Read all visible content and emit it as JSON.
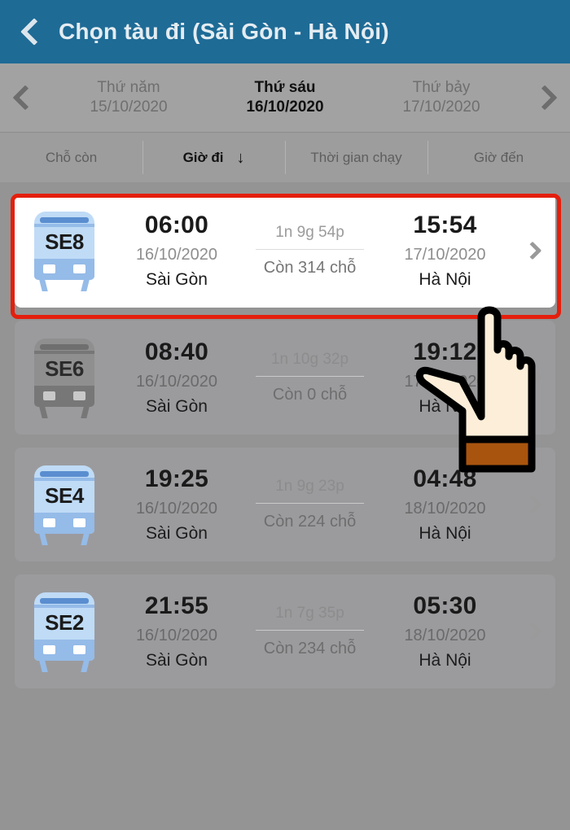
{
  "header": {
    "back_icon": "chevron-left-icon",
    "title": "Chọn tàu đi (Sài Gòn - Hà Nội)",
    "bg_color": "#1e6b96",
    "text_color": "#e4ecf1"
  },
  "date_bar": {
    "prev_icon": "chevron-left-icon",
    "next_icon": "chevron-right-icon",
    "dates": [
      {
        "dow": "Thứ năm",
        "date": "15/10/2020",
        "active": false
      },
      {
        "dow": "Thứ sáu",
        "date": "16/10/2020",
        "active": true
      },
      {
        "dow": "Thứ bảy",
        "date": "17/10/2020",
        "active": false
      }
    ]
  },
  "sort_bar": {
    "items": [
      {
        "label": "Chỗ còn",
        "active": false,
        "arrow": ""
      },
      {
        "label": "Giờ đi",
        "active": true,
        "arrow": "↓"
      },
      {
        "label": "Thời gian chạy",
        "active": false,
        "arrow": ""
      },
      {
        "label": "Giờ đến",
        "active": false,
        "arrow": ""
      }
    ]
  },
  "trains": [
    {
      "code": "SE8",
      "depart_time": "06:00",
      "depart_date": "16/10/2020",
      "depart_station": "Sài Gòn",
      "duration": "1n 9g 54p",
      "seats": "Còn 314 chỗ",
      "arrive_time": "15:54",
      "arrive_date": "17/10/2020",
      "arrive_station": "Hà Nội",
      "sold_out": false,
      "highlighted": true
    },
    {
      "code": "SE6",
      "depart_time": "08:40",
      "depart_date": "16/10/2020",
      "depart_station": "Sài Gòn",
      "duration": "1n 10g 32p",
      "seats": "Còn 0 chỗ",
      "arrive_time": "19:12",
      "arrive_date": "17/10/2020",
      "arrive_station": "Hà Nội",
      "sold_out": true,
      "highlighted": false
    },
    {
      "code": "SE4",
      "depart_time": "19:25",
      "depart_date": "16/10/2020",
      "depart_station": "Sài Gòn",
      "duration": "1n 9g 23p",
      "seats": "Còn 224 chỗ",
      "arrive_time": "04:48",
      "arrive_date": "18/10/2020",
      "arrive_station": "Hà Nội",
      "sold_out": false,
      "highlighted": false
    },
    {
      "code": "SE2",
      "depart_time": "21:55",
      "depart_date": "16/10/2020",
      "depart_station": "Sài Gòn",
      "duration": "1n 7g 35p",
      "seats": "Còn 234 chỗ",
      "arrive_time": "05:30",
      "arrive_date": "18/10/2020",
      "arrive_station": "Hà Nội",
      "sold_out": false,
      "highlighted": false
    }
  ],
  "annotations": {
    "highlight_box_color": "#e41f0c",
    "cursor_icon": "pointing-hand-cursor",
    "cursor_fill": "#fdeed9",
    "cursor_cuff": "#a8540f"
  }
}
